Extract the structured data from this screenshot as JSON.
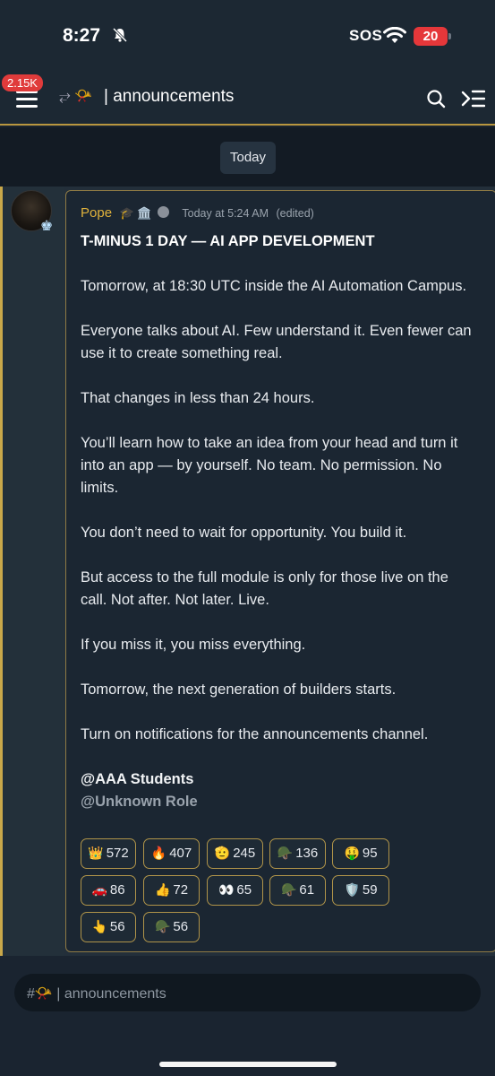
{
  "status_bar": {
    "time": "8:27",
    "sos": "SOS",
    "battery": "20"
  },
  "header": {
    "badge": "2.15K",
    "channel_icons": "⥂ 📯",
    "channel_title": "| announcements"
  },
  "date_separator": "Today",
  "message": {
    "author": "Pope",
    "author_icons": "🎓 🏛️",
    "timestamp": "Today at 5:24 AM",
    "edited": "(edited)",
    "headline": "T-MINUS 1 DAY — AI APP DEVELOPMENT",
    "paragraphs": [
      "Tomorrow, at 18:30 UTC inside the AI Automation Campus.",
      "Everyone talks about AI. Few understand it. Even fewer can use it to create something real.",
      "That changes in less than 24 hours.",
      "You’ll learn how to take an idea from your head and turn it into an app — by yourself. No team. No permission. No limits.",
      "You don’t need to wait for opportunity. You build it.",
      "But access to the full module is only for those live on the call. Not after. Not later. Live.",
      "If you miss it, you miss everything.",
      "Tomorrow, the next generation of builders starts.",
      "Turn on notifications for the announcements channel."
    ],
    "mention_1": "@AAA Students",
    "mention_2": "@Unknown Role"
  },
  "reactions": [
    {
      "emoji": "👑",
      "count": "572"
    },
    {
      "emoji": "🔥",
      "count": "407"
    },
    {
      "emoji": "🫡",
      "count": "245"
    },
    {
      "emoji": "🪖",
      "count": "136"
    },
    {
      "emoji": "🤑",
      "count": "95"
    },
    {
      "emoji": "🚗",
      "count": "86"
    },
    {
      "emoji": "👍",
      "count": "72"
    },
    {
      "emoji": "👀",
      "count": "65"
    },
    {
      "emoji": "🪖",
      "count": "61"
    },
    {
      "emoji": "🛡️",
      "count": "59"
    },
    {
      "emoji": "👆",
      "count": "56"
    },
    {
      "emoji": "🪖",
      "count": "56"
    }
  ],
  "composer": {
    "placeholder": "#📯 | announcements"
  }
}
